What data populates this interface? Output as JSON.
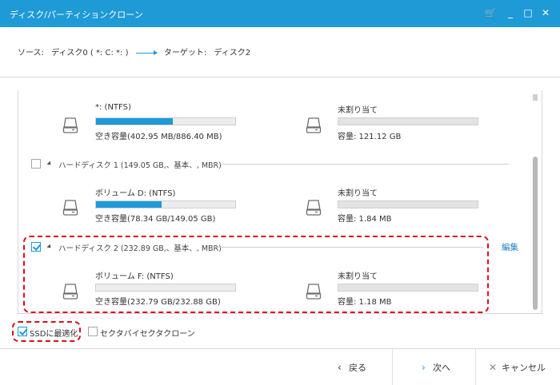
{
  "window": {
    "title": "ディスク/パーティションクローン",
    "cart_glyph": "🛒",
    "minimize_glyph": "_",
    "maximize_glyph": "□",
    "close_glyph": "✕"
  },
  "route": {
    "source_label": "ソース:",
    "source_value": "ディスク0 ( *: C: *: )",
    "target_label": "ターゲット:",
    "target_value": "ディスク2"
  },
  "disk0": {
    "partitions": [
      {
        "name": "*: (NTFS)",
        "capacity_label": "空き容量(402.95 MB/886.40 MB)",
        "used_fraction": 0.55
      },
      {
        "name": "未割り当て",
        "capacity_label": "容量: 121.12 GB",
        "used_fraction": 0
      }
    ]
  },
  "disk1": {
    "header": "ハードディスク 1 (149.05 GB,、基本、, MBR)",
    "partitions": [
      {
        "name": "ボリューム D: (NTFS)",
        "capacity_label": "空き容量(78.34 GB/149.05 GB)",
        "used_fraction": 0.47
      },
      {
        "name": "未割り当て",
        "capacity_label": "容量: 1.84 MB",
        "used_fraction": 0
      }
    ]
  },
  "disk2": {
    "header": "ハードディスク 2 (232.89 GB,、基本、, MBR)",
    "edit_label": "編集",
    "partitions": [
      {
        "name": "ボリューム F: (NTFS)",
        "capacity_label": "空き容量(232.79 GB/232.88 GB)",
        "used_fraction": 0
      },
      {
        "name": "未割り当て",
        "capacity_label": "容量: 1.18 MB",
        "used_fraction": 0
      }
    ]
  },
  "options": {
    "ssd_label": "SSDに最適化",
    "sector_label": "セクタバイセクタクローン"
  },
  "footer": {
    "back_label": "戻る",
    "back_glyph": "‹",
    "next_label": "次へ",
    "next_glyph": "›",
    "cancel_label": "キャンセル",
    "cancel_glyph": "✕"
  },
  "colors": {
    "accent": "#1e9ad6",
    "highlight": "#d4111b"
  }
}
